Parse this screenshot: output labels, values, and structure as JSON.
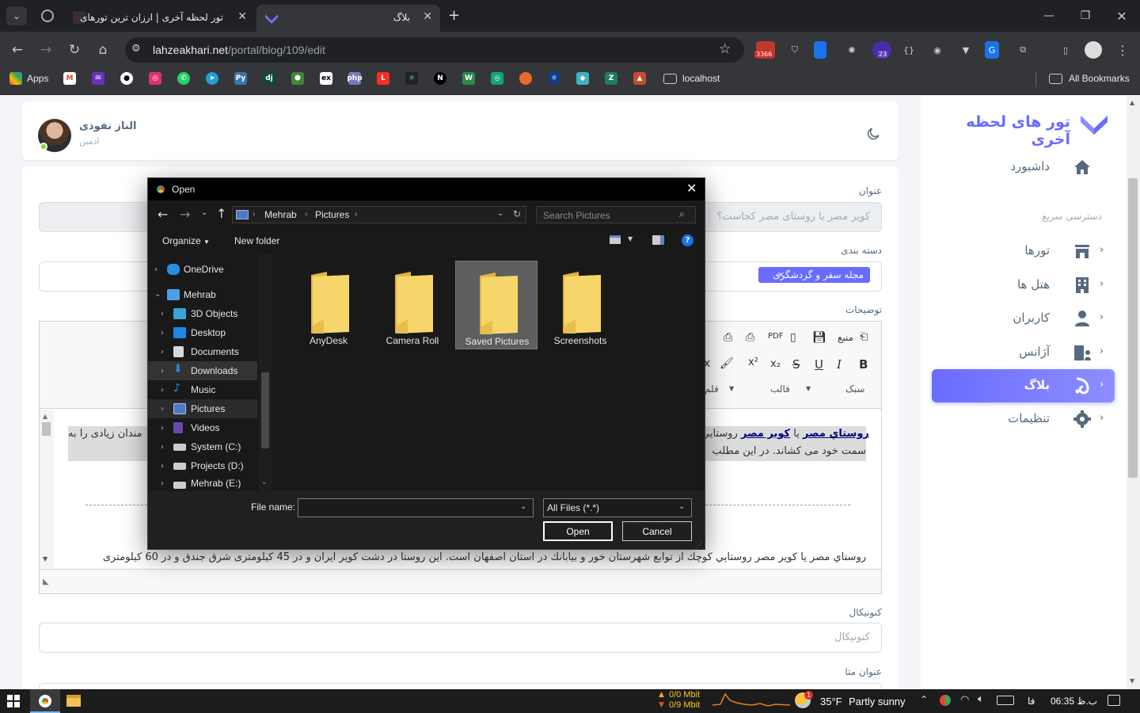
{
  "browser": {
    "tabs": [
      {
        "title": "تور لحظه آخری | ارزان ترین تورهای",
        "active": false
      },
      {
        "title": "بلاگ",
        "active": true
      }
    ],
    "new_tab": "+",
    "url_domain": "lahzeakhari.net",
    "url_path": "/portal/blog/109/edit",
    "extension_badges": {
      "counter": "3366",
      "notifications": "23"
    },
    "bookmarks": {
      "apps_label": "Apps",
      "localhost_label": "localhost",
      "all_bookmarks_label": "All Bookmarks"
    }
  },
  "site": {
    "brand": "تور های لحظه آخری",
    "brand_color": "#696cff",
    "user_name": "الناز نفوذی",
    "user_role": "ادمین",
    "sidebar": {
      "dashboard": "داشبورد",
      "quick_access": "دسترسی سریع",
      "items": [
        {
          "label": "تورها",
          "icon": "store-icon"
        },
        {
          "label": "هتل ها",
          "icon": "building-icon"
        },
        {
          "label": "کاربران",
          "icon": "user-icon"
        },
        {
          "label": "آژانس",
          "icon": "agency-icon"
        },
        {
          "label": "بلاگ",
          "icon": "blog-icon",
          "active": true
        },
        {
          "label": "تنظیمات",
          "icon": "gear-icon"
        }
      ]
    },
    "form": {
      "title_label": "عنوان",
      "title_placeholder": "کویر مصر یا روستای مصر کجاست؟",
      "category_label": "دسته بندی",
      "category_tag": "مجله سفر و گردشگری",
      "description_label": "توضیحات",
      "editor_source": "منبع",
      "editor_style": "سبک",
      "editor_format": "قالب",
      "editor_font": "قلم",
      "body_line1_a": "روستاي مصر",
      "body_line1_b": "یا",
      "body_line1_c": "کوير مصر",
      "body_line1_d": "روستايي",
      "body_line1_end": "مندان زیادی را به",
      "body_line2": "سمت خود می کشاند. در این مطلب",
      "body_p2": "روستاي مصر یا کوير مصر روستايي کوچك از توابع شهرستان خور و بيابانك در استان اصفهان است. این روستا در دشت کویر ایران و در 45 کیلومتری شرق جندق و در 60 کیلومتری",
      "canonical_label": "کنونیکال",
      "canonical_placeholder": "کنونیکال",
      "meta_title_label": "عنوان متا"
    }
  },
  "dialog": {
    "title": "Open",
    "breadcrumb": [
      "Mehrab",
      "Pictures"
    ],
    "search_placeholder": "Search Pictures",
    "organize": "Organize",
    "new_folder": "New folder",
    "tree": [
      {
        "label": "OneDrive",
        "icon": "onedrive-icon"
      },
      {
        "label": "Mehrab",
        "icon": "computer-icon"
      },
      {
        "label": "3D Objects",
        "icon": "3d-objects-icon"
      },
      {
        "label": "Desktop",
        "icon": "desktop-icon"
      },
      {
        "label": "Documents",
        "icon": "documents-icon"
      },
      {
        "label": "Downloads",
        "icon": "downloads-icon"
      },
      {
        "label": "Music",
        "icon": "music-icon"
      },
      {
        "label": "Pictures",
        "icon": "pictures-icon"
      },
      {
        "label": "Videos",
        "icon": "videos-icon"
      },
      {
        "label": "System (C:)",
        "icon": "drive-icon"
      },
      {
        "label": "Projects (D:)",
        "icon": "drive-icon"
      },
      {
        "label": "Mehrab (E:)",
        "icon": "drive-icon"
      }
    ],
    "folders": [
      "AnyDesk",
      "Camera Roll",
      "Saved Pictures",
      "Screenshots"
    ],
    "file_name_label": "File name:",
    "file_name_value": "",
    "file_type": "All Files (*.*)",
    "open_button": "Open",
    "cancel_button": "Cancel"
  },
  "taskbar": {
    "net_up": "0/0 Mbit",
    "net_down": "0/9 Mbit",
    "weather_temp": "35°F",
    "weather_desc": "Partly sunny",
    "weather_badge": "1",
    "lang": "فا",
    "time": "06:35 ب.ظ"
  }
}
